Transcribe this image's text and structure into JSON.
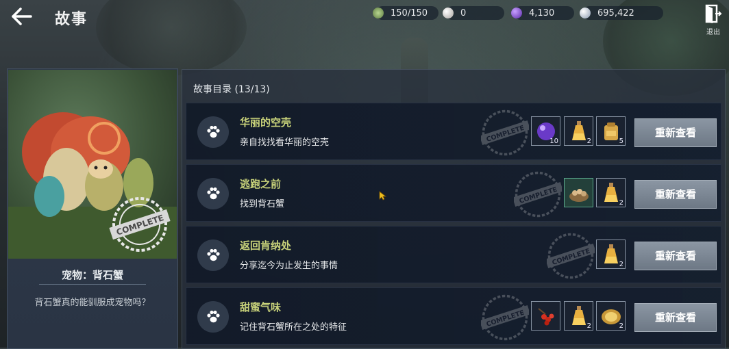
{
  "header": {
    "title": "故事",
    "exit_label": "退出",
    "resources": [
      {
        "icon": "leaf-energy-icon",
        "value": "150/150",
        "color": "#8fb070"
      },
      {
        "icon": "pearl-icon",
        "value": "0",
        "color": "#d8d4d0"
      },
      {
        "icon": "purple-gem-icon",
        "value": "4,130",
        "color": "#8a5ad8"
      },
      {
        "icon": "silver-coin-icon",
        "value": "695,422",
        "color": "#c8d4e4"
      }
    ]
  },
  "pet": {
    "name": "宠物：背石蟹",
    "question": "背石蟹真的能驯服成宠物吗？",
    "stamp_text": "COMPLETE"
  },
  "stories": {
    "header": "故事目录 (13/13)",
    "button_label": "重新查看",
    "stamp_text": "COMPLETE",
    "items": [
      {
        "title": "华丽的空壳",
        "desc": "亲自找找看华丽的空壳",
        "rewards": [
          {
            "icon": "purple-orb-icon",
            "count": "10"
          },
          {
            "icon": "potion-bottle-icon",
            "count": "2"
          },
          {
            "icon": "gold-backpack-icon",
            "count": "5"
          }
        ]
      },
      {
        "title": "逃跑之前",
        "desc": "找到背石蟹",
        "rewards": [
          {
            "icon": "pet-food-bowl-icon",
            "count": ""
          },
          {
            "icon": "potion-bottle-icon",
            "count": "2"
          }
        ]
      },
      {
        "title": "返回肯纳处",
        "desc": "分享迄今为止发生的事情",
        "rewards": [
          {
            "icon": "potion-bottle-icon",
            "count": "2"
          }
        ]
      },
      {
        "title": "甜蜜气味",
        "desc": "记住背石蟹所在之处的特征",
        "rewards": [
          {
            "icon": "red-berries-icon",
            "count": ""
          },
          {
            "icon": "potion-bottle-icon",
            "count": "2"
          },
          {
            "icon": "gold-plate-icon",
            "count": "2"
          }
        ]
      }
    ]
  }
}
